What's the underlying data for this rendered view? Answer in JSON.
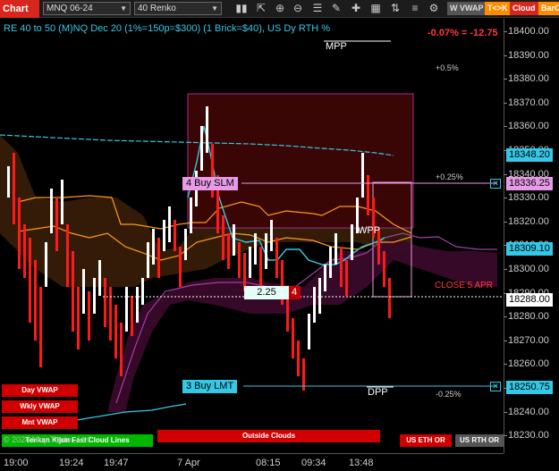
{
  "toolbar": {
    "chart_label": "Chart",
    "instrument": "MNQ 06-24",
    "bar_type": "40 Renko",
    "tags": {
      "vwap": "W VWAP",
      "tk": "T<>K",
      "cloud": "Cloud",
      "barco": "BarCo"
    }
  },
  "header": {
    "title": "RE 40 to 50 (M)NQ Dec 20 (1%=150p=$300) (1 Brick=$40), US Dy RTH %",
    "change": "-0.07% = -12.75"
  },
  "levels": {
    "mpp": "MPP",
    "wpp": "WPP",
    "dpp": "DPP",
    "pct_05": "+0.5%",
    "pct_025": "+0.25%",
    "pct_neg025": "-0.25%",
    "close_label": "CLOSE 5 APR"
  },
  "orders": {
    "buy_slm": "4  Buy SLM",
    "buy_lmt": "3  Buy LMT",
    "position_price": "2.25",
    "position_qty": "4"
  },
  "price_axis": {
    "ticks": [
      "18400.00",
      "18390.00",
      "18380.00",
      "18370.00",
      "18360.00",
      "18350.00",
      "18340.00",
      "18330.00",
      "18320.00",
      "18310.00",
      "18300.00",
      "18290.00",
      "18280.00",
      "18270.00",
      "18260.00",
      "18250.00",
      "18240.00",
      "18230.00"
    ],
    "badges": {
      "cyan1": "18348.20",
      "pink": "18336.25",
      "cyan2": "18309.10",
      "white": "18288.00",
      "cyan3": "18250.75"
    }
  },
  "time_axis": {
    "ticks": [
      "19:00",
      "19:24",
      "19:47",
      "7 Apr",
      "08:15",
      "09:34",
      "13:48"
    ]
  },
  "side_buttons": {
    "day_vwap": "Day VWAP",
    "wkly_vwap": "Wkly VWAP",
    "mnt_vwap": "Mnt VWAP",
    "tenkan": "Tenkan Kijun Fast Cloud Lines",
    "outside": "Outside Clouds",
    "us_eth": "US ETH OR",
    "us_rth": "US RTH OR"
  },
  "copyright": "© 2024 NinjaTrader, LLC",
  "icons": [
    "cursor-icon",
    "hand-icon",
    "zoom-in-icon",
    "zoom-out-icon",
    "properties-icon",
    "plus-icon",
    "draw-icon",
    "bars-icon",
    "grid-icon",
    "indicators-icon",
    "strategies-icon"
  ],
  "colors": {
    "accent_red": "#d9261c",
    "cyan": "#35c8e6",
    "pink_order": "#e89ae8",
    "up_bar": "#ffffff",
    "down_bar": "#ff1a1a"
  }
}
